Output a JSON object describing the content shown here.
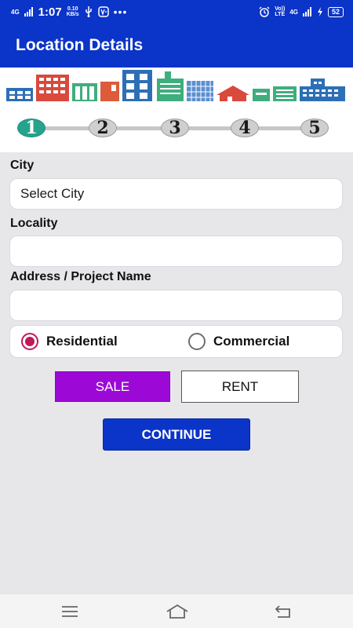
{
  "status_bar": {
    "network": "4G",
    "time": "1:07",
    "speed_value": "0.10",
    "speed_unit": "KB/s",
    "right_small_1": "Vo))",
    "right_small_2": "LTE",
    "net2": "4G",
    "battery": "52"
  },
  "app_bar": {
    "title": "Location Details"
  },
  "stepper": {
    "steps": [
      "1",
      "2",
      "3",
      "4",
      "5"
    ],
    "active_step": 1
  },
  "form": {
    "city_label": "City",
    "city_value": "Select City",
    "locality_label": "Locality",
    "locality_value": "",
    "address_label": "Address / Project Name",
    "address_value": ""
  },
  "property_type": {
    "options": [
      "Residential",
      "Commercial"
    ],
    "selected": "Residential"
  },
  "deal_type": {
    "sale_label": "SALE",
    "rent_label": "RENT",
    "selected": "SALE"
  },
  "actions": {
    "continue_label": "CONTINUE"
  },
  "colors": {
    "primary": "#0b34c8",
    "sale_selected": "#9c09d6",
    "radio_accent": "#c2185b",
    "step_active": "#26a38f"
  }
}
